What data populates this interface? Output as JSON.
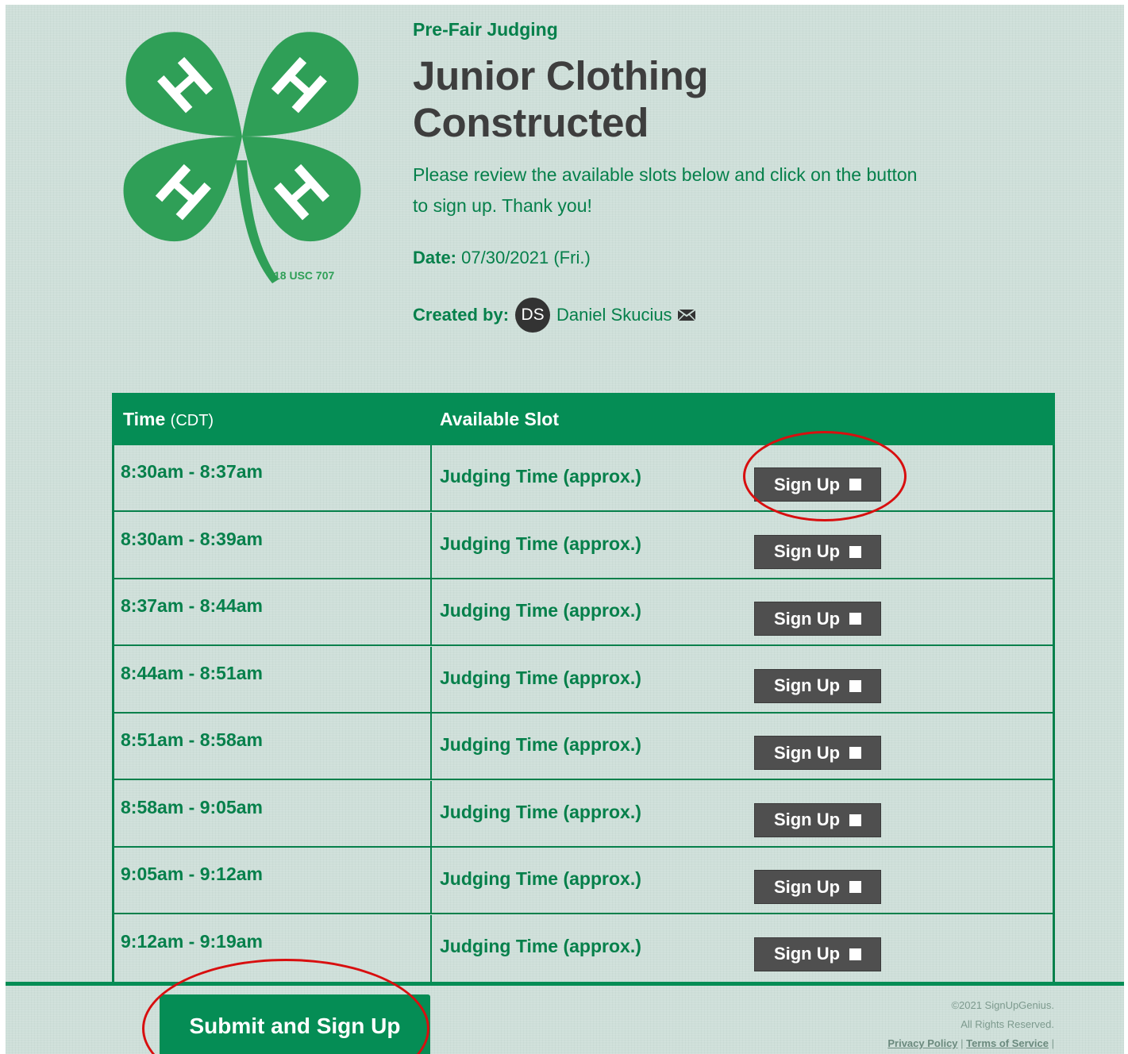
{
  "header": {
    "subtitle": "Pre-Fair Judging",
    "title": "Junior Clothing Constructed",
    "intro": "Please review the available slots below and click on the button to sign up. Thank you!",
    "date_label": "Date:",
    "date_value": "07/30/2021 (Fri.)",
    "created_by_label": "Created by:",
    "creator_initials": "DS",
    "creator_name": "Daniel Skucius",
    "logo_text": "18 USC 707",
    "logo_letter": "H"
  },
  "table": {
    "col_time": "Time",
    "col_time_tz": "(CDT)",
    "col_slot": "Available Slot",
    "signup_label": "Sign Up",
    "rows": [
      {
        "time": "8:30am - 8:37am",
        "slot": "Judging Time (approx.)"
      },
      {
        "time": "8:30am - 8:39am",
        "slot": "Judging Time (approx.)"
      },
      {
        "time": "8:37am - 8:44am",
        "slot": "Judging Time (approx.)"
      },
      {
        "time": "8:44am - 8:51am",
        "slot": "Judging Time (approx.)"
      },
      {
        "time": "8:51am - 8:58am",
        "slot": "Judging Time (approx.)"
      },
      {
        "time": "8:58am - 9:05am",
        "slot": "Judging Time (approx.)"
      },
      {
        "time": "9:05am - 9:12am",
        "slot": "Judging Time (approx.)"
      },
      {
        "time": "9:12am - 9:19am",
        "slot": "Judging Time (approx.)"
      }
    ]
  },
  "footer": {
    "submit_label": "Submit and Sign Up",
    "copyright": "©2021 SignUpGenius.",
    "rights": "All Rights Reserved.",
    "privacy": "Privacy Policy",
    "sep": "|",
    "terms": "Terms of Service",
    "sep_end": "|"
  },
  "colors": {
    "brand_green": "#058d55",
    "text_green": "#06804b",
    "button_gray": "#4f4f4f",
    "background": "#cedfd9",
    "annotation_red": "#d80f0f"
  },
  "icons": [
    "four-leaf-clover-logo",
    "mail-icon",
    "checkbox-icon"
  ]
}
